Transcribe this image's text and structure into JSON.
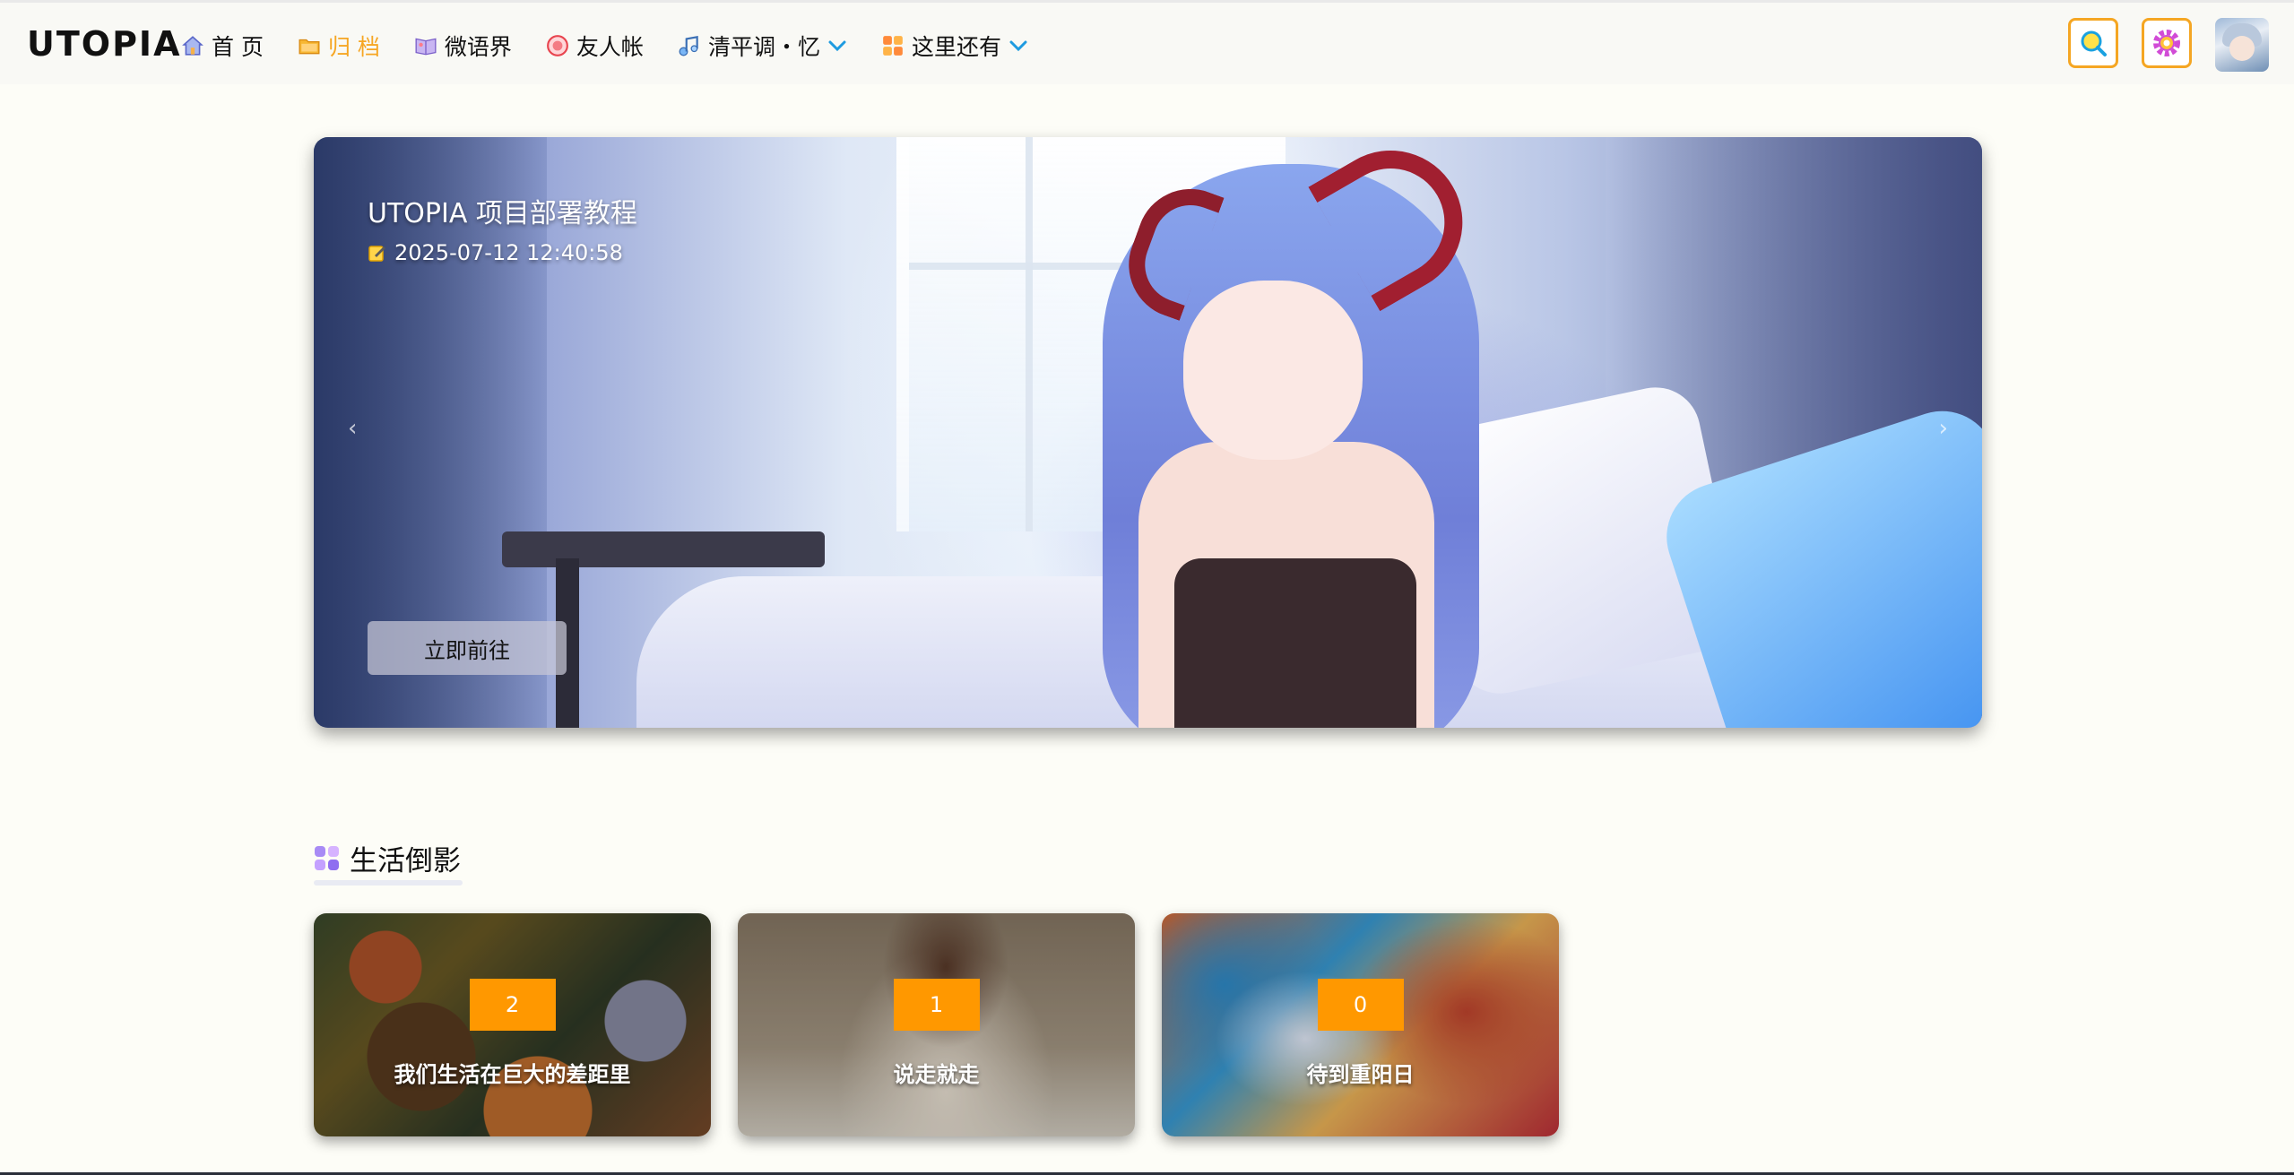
{
  "brand": "UTOPIA",
  "nav": [
    {
      "label": "首 页",
      "icon": "home-icon",
      "active": false
    },
    {
      "label": "归 档",
      "icon": "folder-icon",
      "active": true
    },
    {
      "label": "微语界",
      "icon": "book-icon",
      "active": false
    },
    {
      "label": "友人帐",
      "icon": "friend-badge-icon",
      "active": false
    },
    {
      "label": "清平调・忆",
      "icon": "music-icon",
      "active": false,
      "dropdown": true
    },
    {
      "label": "这里还有",
      "icon": "apps-icon",
      "active": false,
      "dropdown": true
    }
  ],
  "top_right": {
    "search_icon": "search-icon",
    "settings_icon": "gear-icon",
    "avatar_icon": "avatar"
  },
  "hero": {
    "title": "UTOPIA 项目部署教程",
    "date": "2025-07-12 12:40:58",
    "date_icon": "edit-icon",
    "button": "立即前往",
    "prev_arrow": "‹",
    "next_arrow": "›"
  },
  "section": {
    "title": "生活倒影",
    "icon": "grid-icon"
  },
  "cards": [
    {
      "count": "2",
      "name": "我们生活在巨大的差距里"
    },
    {
      "count": "1",
      "name": "说走就走"
    },
    {
      "count": "0",
      "name": "待到重阳日"
    }
  ],
  "colors": {
    "accent": "#f6a623",
    "badge": "#ff9800",
    "chevron": "#1e9be0"
  }
}
